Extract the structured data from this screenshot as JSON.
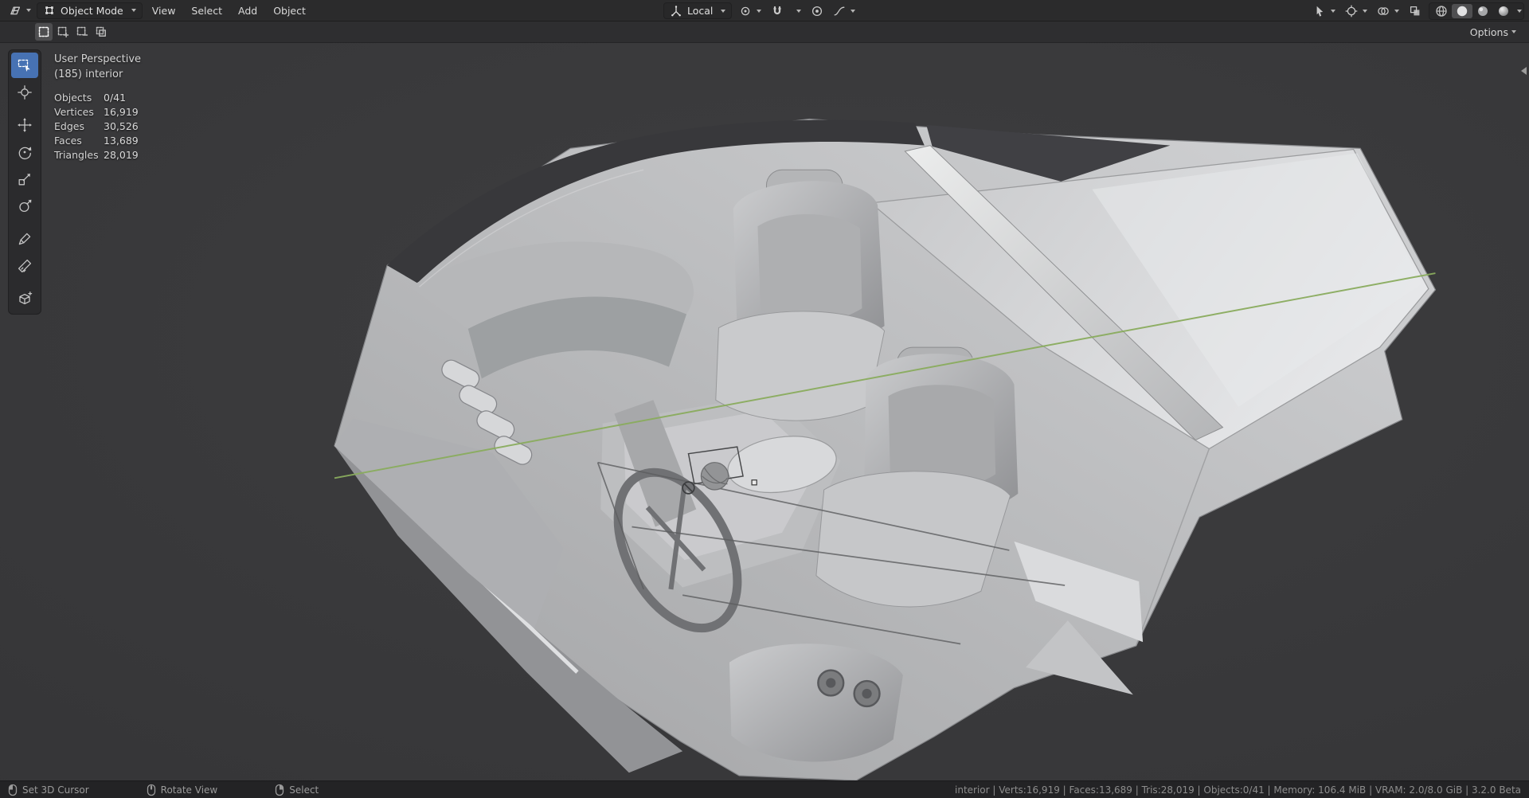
{
  "app": {
    "name": "Blender - 3D Viewport"
  },
  "topbar": {
    "mode_label": "Object Mode",
    "menus": [
      {
        "label": "View"
      },
      {
        "label": "Select"
      },
      {
        "label": "Add"
      },
      {
        "label": "Object"
      }
    ],
    "orientation_label": "Local",
    "options_label": "Options",
    "shading": {
      "modes": [
        "wireframe",
        "solid",
        "material-preview",
        "rendered"
      ],
      "active": "solid"
    }
  },
  "toolbar": {
    "active_tool": "select-box",
    "tools": [
      {
        "name": "select-box"
      },
      {
        "name": "cursor"
      },
      {
        "name": "move"
      },
      {
        "name": "rotate"
      },
      {
        "name": "scale"
      },
      {
        "name": "transform"
      },
      {
        "name": "annotate"
      },
      {
        "name": "measure"
      },
      {
        "name": "add-cube"
      }
    ]
  },
  "viewport_overlay": {
    "title": "User Perspective",
    "subtitle": "(185) interior",
    "stats": [
      {
        "label": "Objects",
        "value": "0/41"
      },
      {
        "label": "Vertices",
        "value": "16,919"
      },
      {
        "label": "Edges",
        "value": "30,526"
      },
      {
        "label": "Faces",
        "value": "13,689"
      },
      {
        "label": "Triangles",
        "value": "28,019"
      }
    ]
  },
  "statusbar": {
    "hints": [
      {
        "button": "left-mouse",
        "label": "Set 3D Cursor"
      },
      {
        "button": "middle-mouse",
        "label": "Rotate View"
      },
      {
        "button": "right-mouse",
        "label": "Select"
      }
    ],
    "info": "interior | Verts:16,919 | Faces:13,689 | Tris:28,019 | Objects:0/41 | Memory: 106.4 MiB | VRAM: 2.0/8.0 GiB | 3.2.0 Beta"
  },
  "colors": {
    "accent": "#4772b3",
    "axis_y_green": "#8aac5e",
    "viewport_bg": "#3a3a3c",
    "model_gray": "#c0c1c3"
  }
}
